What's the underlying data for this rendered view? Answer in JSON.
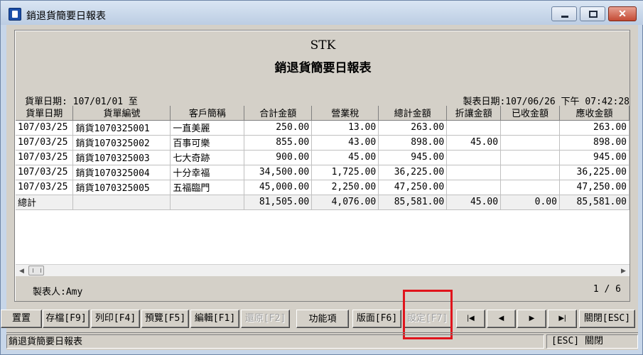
{
  "window": {
    "title": "銷退貨簡要日報表"
  },
  "report": {
    "company": "STK",
    "title": "銷退貨簡要日報表",
    "date_range": "貨單日期: 107/01/01 至",
    "print_date": "製表日期:107/06/26 下午 07:42:28",
    "maker": "製表人:Amy",
    "page": "1 / 6"
  },
  "table": {
    "headers": [
      "貨單日期",
      "貨單編號",
      "客戶簡稱",
      "合計金額",
      "營業稅",
      "總計金額",
      "折讓金額",
      "已收金額",
      "應收金額"
    ],
    "rows": [
      [
        "107/03/25",
        "銷貨1070325001",
        "一直美麗",
        "250.00",
        "13.00",
        "263.00",
        "",
        "",
        "263.00"
      ],
      [
        "107/03/25",
        "銷貨1070325002",
        "百事可樂",
        "855.00",
        "43.00",
        "898.00",
        "45.00",
        "",
        "898.00"
      ],
      [
        "107/03/25",
        "銷貨1070325003",
        "七大奇跡",
        "900.00",
        "45.00",
        "945.00",
        "",
        "",
        "945.00"
      ],
      [
        "107/03/25",
        "銷貨1070325004",
        "十分幸福",
        "34,500.00",
        "1,725.00",
        "36,225.00",
        "",
        "",
        "36,225.00"
      ],
      [
        "107/03/25",
        "銷貨1070325005",
        "五福臨門",
        "45,000.00",
        "2,250.00",
        "47,250.00",
        "",
        "",
        "47,250.00"
      ]
    ],
    "total": [
      "總計",
      "",
      "",
      "81,505.00",
      "4,076.00",
      "85,581.00",
      "45.00",
      "0.00",
      "85,581.00"
    ]
  },
  "toolbar": {
    "b0": "置置",
    "b1": "存檔[F9]",
    "b2": "列印[F4]",
    "b3": "預覽[F5]",
    "b4": "編輯[F1]",
    "b5": "還原[F2]",
    "b6": "功能項",
    "b7": "版面[F6]",
    "b8": "設定[F7]",
    "b13": "關閉[ESC]"
  },
  "status": {
    "left": "銷退貨簡要日報表",
    "right": "[ESC] 關閉"
  },
  "colors": {
    "highlight": "#e0141c",
    "titlebar": "#c7d6e9",
    "face": "#d4d0c8"
  }
}
